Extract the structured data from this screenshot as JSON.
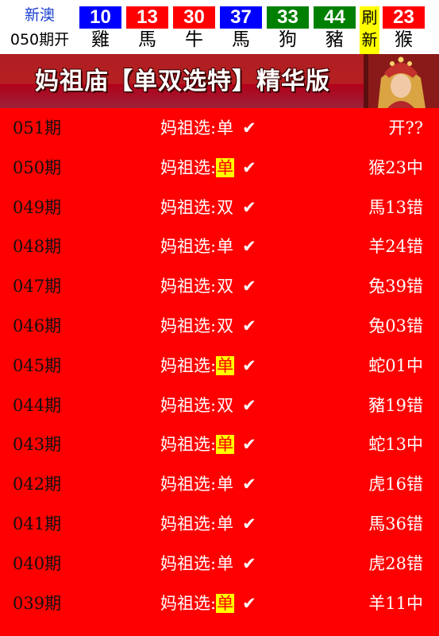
{
  "header": {
    "site_name": "新澳",
    "issue_label": "050期开",
    "refresh_chars": [
      "刷",
      "新"
    ],
    "balls": [
      {
        "number": "10",
        "zodiac": "雞",
        "color": "#0000ff"
      },
      {
        "number": "13",
        "zodiac": "馬",
        "color": "#ff0000"
      },
      {
        "number": "30",
        "zodiac": "牛",
        "color": "#ff0000"
      },
      {
        "number": "37",
        "zodiac": "馬",
        "color": "#0000ff"
      },
      {
        "number": "33",
        "zodiac": "狗",
        "color": "#008000"
      },
      {
        "number": "44",
        "zodiac": "豬",
        "color": "#008000"
      }
    ],
    "special": {
      "number": "23",
      "zodiac": "猴",
      "color": "#ff0000"
    }
  },
  "banner": {
    "title": "妈祖庙【单双选特】精华版"
  },
  "rows": [
    {
      "period": "051期",
      "label": "妈祖选:",
      "pick": "单",
      "highlight": false,
      "check": "✔",
      "result": "开??"
    },
    {
      "period": "050期",
      "label": "妈祖选:",
      "pick": "单",
      "highlight": true,
      "check": "✔",
      "result": "猴23中"
    },
    {
      "period": "049期",
      "label": "妈祖选:",
      "pick": "双",
      "highlight": false,
      "check": "✔",
      "result": "馬13错"
    },
    {
      "period": "048期",
      "label": "妈祖选:",
      "pick": "单",
      "highlight": false,
      "check": "✔",
      "result": "羊24错"
    },
    {
      "period": "047期",
      "label": "妈祖选:",
      "pick": "双",
      "highlight": false,
      "check": "✔",
      "result": "兔39错"
    },
    {
      "period": "046期",
      "label": "妈祖选:",
      "pick": "双",
      "highlight": false,
      "check": "✔",
      "result": "兔03错"
    },
    {
      "period": "045期",
      "label": "妈祖选:",
      "pick": "单",
      "highlight": true,
      "check": "✔",
      "result": "蛇01中"
    },
    {
      "period": "044期",
      "label": "妈祖选:",
      "pick": "双",
      "highlight": false,
      "check": "✔",
      "result": "豬19错"
    },
    {
      "period": "043期",
      "label": "妈祖选:",
      "pick": "单",
      "highlight": true,
      "check": "✔",
      "result": "蛇13中"
    },
    {
      "period": "042期",
      "label": "妈祖选:",
      "pick": "单",
      "highlight": false,
      "check": "✔",
      "result": "虎16错"
    },
    {
      "period": "041期",
      "label": "妈祖选:",
      "pick": "单",
      "highlight": false,
      "check": "✔",
      "result": "馬36错"
    },
    {
      "period": "040期",
      "label": "妈祖选:",
      "pick": "单",
      "highlight": false,
      "check": "✔",
      "result": "虎28错"
    },
    {
      "period": "039期",
      "label": "妈祖选:",
      "pick": "单",
      "highlight": true,
      "check": "✔",
      "result": "羊11中"
    }
  ]
}
